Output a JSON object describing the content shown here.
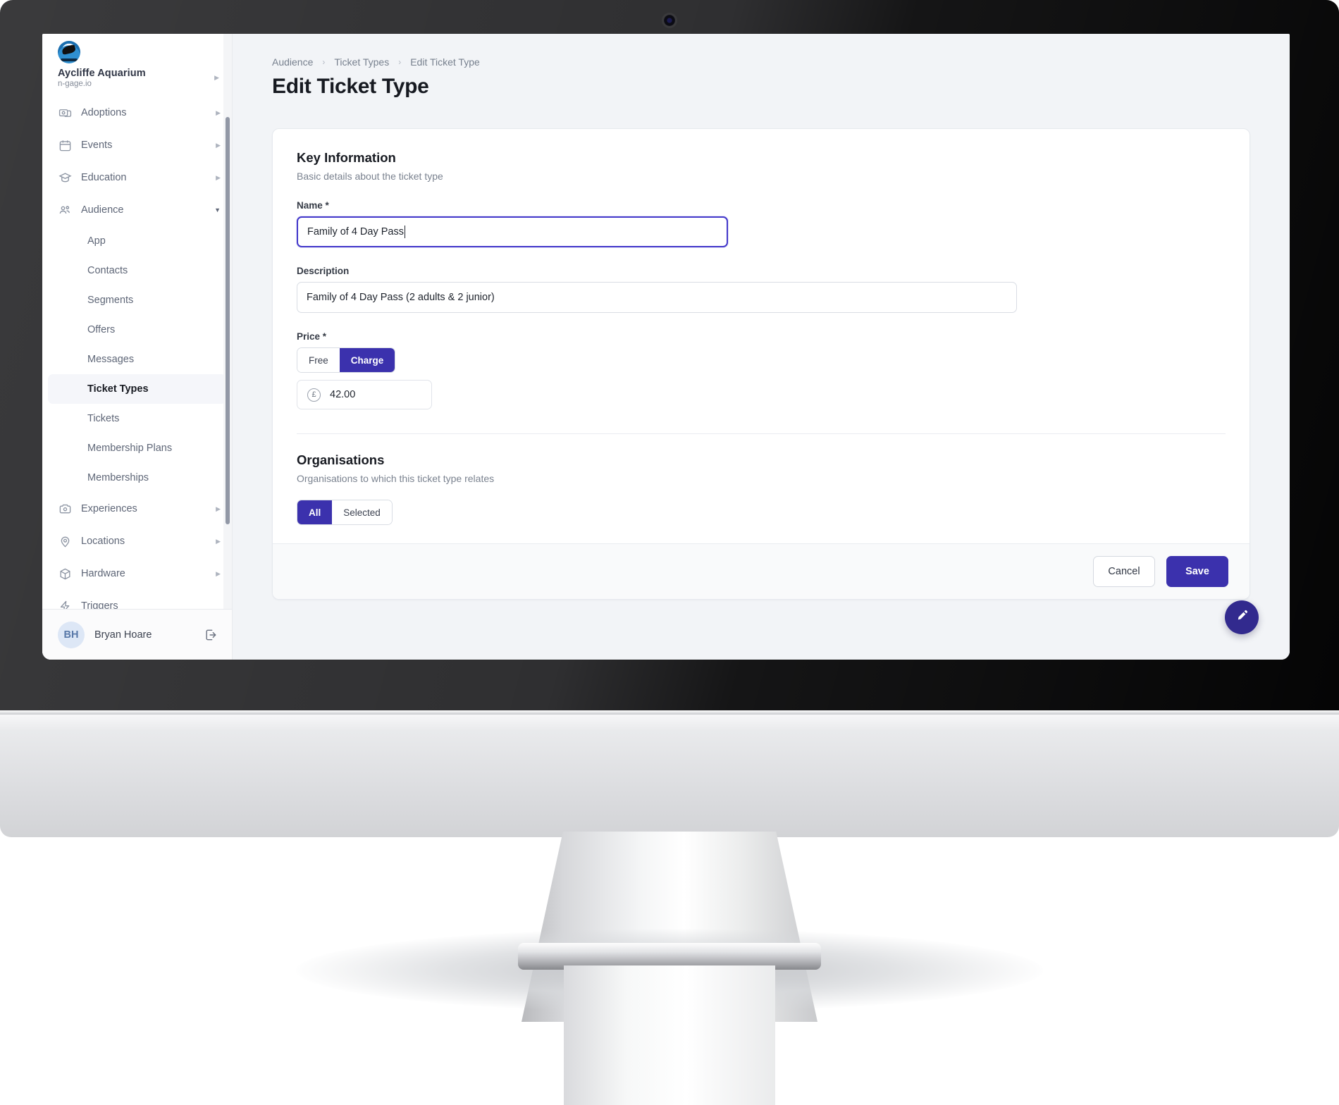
{
  "brand": {
    "name": "Aycliffe Aquarium",
    "domain": "n-gage.io",
    "logo_icon": "aquarium-logo",
    "caret": "▶"
  },
  "sidebar": {
    "nav": [
      {
        "label": "Adoptions",
        "icon": "adoptions-icon",
        "caret": "▶",
        "expanded": false
      },
      {
        "label": "Events",
        "icon": "calendar-icon",
        "caret": "▶",
        "expanded": false
      },
      {
        "label": "Education",
        "icon": "graduation-icon",
        "caret": "▶",
        "expanded": false
      },
      {
        "label": "Audience",
        "icon": "people-icon",
        "caret": "▼",
        "expanded": true
      }
    ],
    "audience_children": [
      {
        "label": "App",
        "active": false
      },
      {
        "label": "Contacts",
        "active": false
      },
      {
        "label": "Segments",
        "active": false
      },
      {
        "label": "Offers",
        "active": false
      },
      {
        "label": "Messages",
        "active": false
      },
      {
        "label": "Ticket Types",
        "active": true
      },
      {
        "label": "Tickets",
        "active": false
      },
      {
        "label": "Membership Plans",
        "active": false
      },
      {
        "label": "Memberships",
        "active": false
      }
    ],
    "nav_bottom": [
      {
        "label": "Experiences",
        "icon": "camera-icon",
        "caret": "▶"
      },
      {
        "label": "Locations",
        "icon": "pin-icon",
        "caret": "▶"
      },
      {
        "label": "Hardware",
        "icon": "cube-icon",
        "caret": "▶"
      },
      {
        "label": "Triggers",
        "icon": "lightning-icon",
        "caret": ""
      }
    ],
    "user": {
      "initials": "BH",
      "name": "Bryan Hoare",
      "logout_icon": "logout-icon"
    }
  },
  "main": {
    "breadcrumb": [
      {
        "label": "Audience"
      },
      {
        "label": "Ticket Types"
      },
      {
        "label": "Edit Ticket Type"
      }
    ],
    "breadcrumb_separator": "›",
    "page_title": "Edit Ticket Type",
    "key_information": {
      "title": "Key Information",
      "subtitle": "Basic details about the ticket type",
      "name_label": "Name *",
      "name_value": "Family of 4 Day Pass",
      "description_label": "Description",
      "description_value": "Family of 4 Day Pass (2 adults & 2 junior)",
      "price_label": "Price *",
      "price_options": [
        {
          "label": "Free",
          "selected": false
        },
        {
          "label": "Charge",
          "selected": true
        }
      ],
      "currency_symbol": "£",
      "price_value": "42.00"
    },
    "organisations": {
      "title": "Organisations",
      "subtitle": "Organisations to which this ticket type relates",
      "options": [
        {
          "label": "All",
          "selected": true
        },
        {
          "label": "Selected",
          "selected": false
        }
      ]
    },
    "footer": {
      "cancel_label": "Cancel",
      "save_label": "Save"
    },
    "fab_icon": "pencil-icon"
  },
  "colors": {
    "accent": "#3b31ad",
    "accent_dark": "#322a8e",
    "focus_border": "#4338ca",
    "page_bg": "#f2f4f7"
  }
}
